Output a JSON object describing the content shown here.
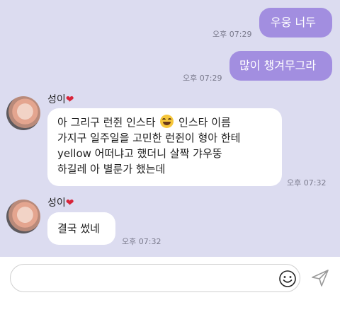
{
  "messages_out": [
    {
      "text": "우웅 너두",
      "time": "오후 07:29"
    },
    {
      "text": "많이 챙겨무그라",
      "time": "오후 07:29"
    }
  ],
  "messages_in": [
    {
      "sender": "성이",
      "heart": "❤",
      "lines": [
        {
          "before": "아 그리구 런쥔 인스타 ",
          "after": " 인스타 이름"
        },
        {
          "text": "가지구 일주일을 고민한 런쥔이 형아 한테"
        },
        {
          "text": "yellow 어떠냐고 했더니 살짝 갸우뚱"
        },
        {
          "text": "하길레 아 별룬가 했는데"
        }
      ],
      "emoji": "grinning-squint-emoji",
      "time": "오후 07:32"
    },
    {
      "sender": "성이",
      "heart": "❤",
      "text": "결국 썼네",
      "time": "오후 07:32"
    }
  ],
  "composer": {
    "placeholder": "",
    "value": "",
    "emoji_icon": "smiley-icon",
    "send_icon": "send-icon"
  },
  "colors": {
    "chat_background": "#dcdcf0",
    "outgoing_bubble": "#a28ee0",
    "incoming_bubble": "#ffffff"
  }
}
